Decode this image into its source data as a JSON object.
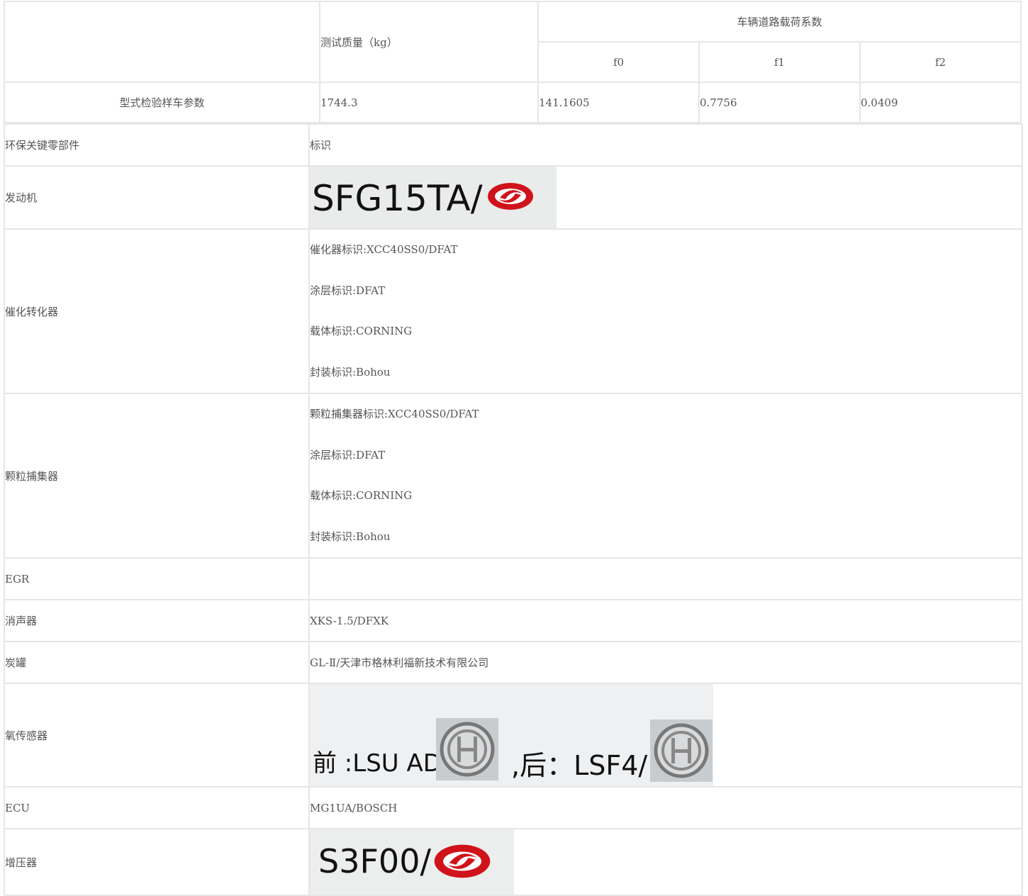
{
  "table1": {
    "header": {
      "test_mass": "测试质量（kg）",
      "load_coeff": "车辆道路载荷系数",
      "f0": "f0",
      "f1": "f1",
      "f2": "f2"
    },
    "row": {
      "label": "型式检验样车参数",
      "mass": "1744.3",
      "f0": "141.1605",
      "f1": "0.7756",
      "f2": "0.0409"
    }
  },
  "table2": {
    "header": {
      "part": "环保关键零部件",
      "mark": "标识"
    },
    "engine": {
      "label": "发动机",
      "image_text": "SFG15TA/"
    },
    "catalyst": {
      "label": "催化转化器",
      "lines": [
        "催化器标识:XCC40SS0/DFAT",
        "涂层标识:DFAT",
        "载体标识:CORNING",
        "封装标识:Bohou"
      ]
    },
    "particulate": {
      "label": "颗粒捕集器",
      "lines": [
        "颗粒捕集器标识:XCC40SS0/DFAT",
        "涂层标识:DFAT",
        "载体标识:CORNING",
        "封装标识:Bohou"
      ]
    },
    "egr": {
      "label": "EGR",
      "value": ""
    },
    "muffler": {
      "label": "消声器",
      "value": "XKS-1.5/DFXK"
    },
    "canister": {
      "label": "炭罐",
      "value": "GL-Ⅱ/天津市格林利福新技术有限公司"
    },
    "o2sensor": {
      "label": "氧传感器",
      "front": "前 :LSU ADV/",
      "rear": ",后：LSF4/"
    },
    "ecu": {
      "label": "ECU",
      "value": "MG1UA/BOSCH"
    },
    "turbo": {
      "label": "增压器",
      "image_text": "S3F00/"
    }
  },
  "colors": {
    "border": "#e6e6e6",
    "text": "#555555",
    "logo_red": "#d0121b",
    "image_bg": "#e9ecea"
  },
  "icons": {
    "dongfeng_logo": "dongfeng-logo-icon",
    "bosch_logo": "bosch-logo-icon"
  }
}
